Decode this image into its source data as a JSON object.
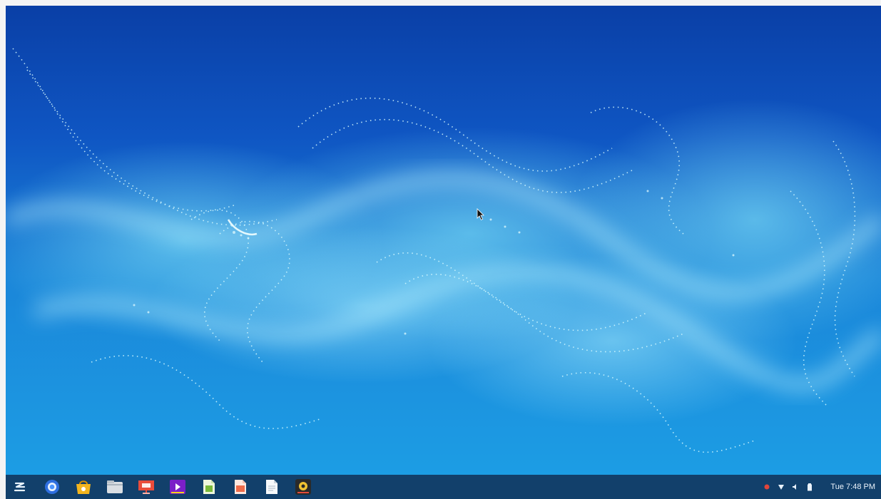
{
  "taskbar": {
    "launcher_icon": "zorin-launcher-icon",
    "apps": [
      {
        "name": "chrome",
        "icon": "chromium-browser-icon"
      },
      {
        "name": "software",
        "icon": "software-store-icon"
      },
      {
        "name": "files",
        "icon": "file-manager-icon"
      },
      {
        "name": "impress",
        "icon": "presentation-app-icon"
      },
      {
        "name": "video",
        "icon": "video-player-icon"
      },
      {
        "name": "calc",
        "icon": "spreadsheet-app-icon"
      },
      {
        "name": "draw",
        "icon": "document-app-icon"
      },
      {
        "name": "writer",
        "icon": "text-document-icon"
      },
      {
        "name": "recorder",
        "icon": "screen-recorder-icon"
      }
    ],
    "tray": {
      "icons": [
        "record-indicator-icon",
        "wifi-icon",
        "volume-icon",
        "battery-icon"
      ],
      "clock": "Tue 7:48 PM"
    }
  },
  "colors": {
    "taskbar_bg": "#12406b",
    "desktop_top": "#0a3fa6",
    "desktop_bottom": "#1c9de4"
  }
}
